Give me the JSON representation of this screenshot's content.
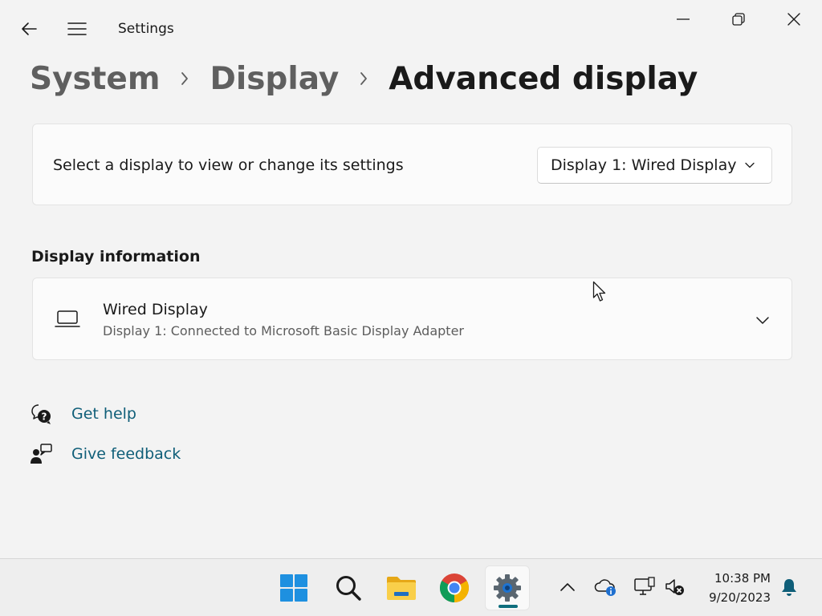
{
  "window": {
    "app_title": "Settings",
    "back_icon": "back-arrow-icon",
    "menu_icon": "hamburger-menu-icon",
    "controls": {
      "minimize_icon": "minimize-icon",
      "maximize_icon": "restore-icon",
      "close_icon": "close-icon"
    }
  },
  "breadcrumb": {
    "items": [
      "System",
      "Display",
      "Advanced display"
    ],
    "separator_icon": "chevron-right-icon"
  },
  "display_select": {
    "label": "Select a display to view or change its settings",
    "selected_value": "Display 1: Wired Display"
  },
  "display_info": {
    "section_title": "Display information",
    "card_title": "Wired Display",
    "card_subtitle": "Display 1: Connected to Microsoft Basic Display Adapter",
    "icon": "laptop-icon"
  },
  "links": {
    "get_help": "Get help",
    "give_feedback": "Give feedback"
  },
  "taskbar": {
    "apps": [
      "start-icon",
      "search-icon",
      "file-explorer-icon",
      "chrome-icon",
      "settings-icon"
    ],
    "active_app": "settings",
    "tray": [
      "show-hidden-icons-icon",
      "onedrive-icon",
      "network-icon",
      "volume-muted-icon"
    ],
    "clock_time": "10:38 PM",
    "clock_date": "9/20/2023",
    "notification_icon": "bell-icon"
  },
  "colors": {
    "accent": "#0f6e7d",
    "link": "#0f5e78",
    "background": "#f3f3f3",
    "card": "#fbfbfb"
  }
}
